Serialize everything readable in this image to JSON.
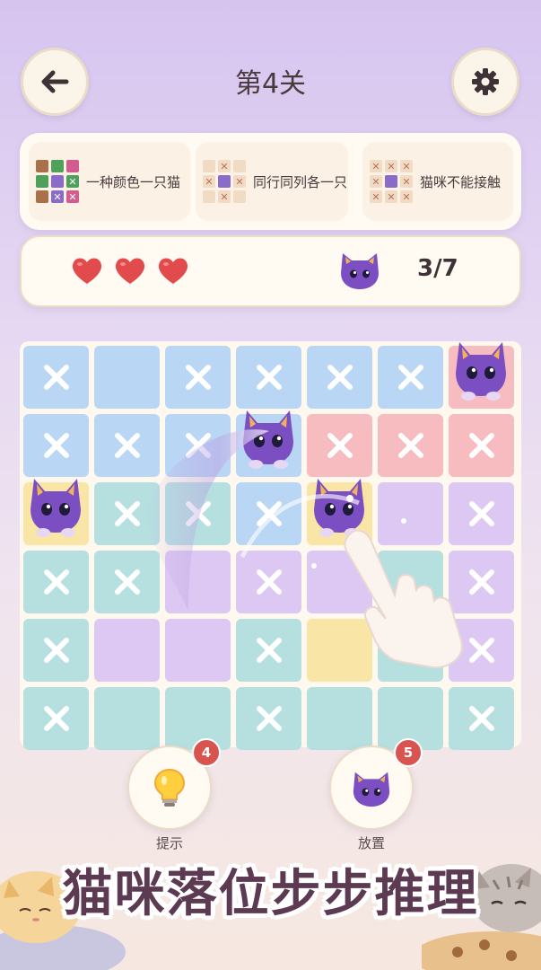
{
  "header": {
    "title": "第4关",
    "back_icon": "arrow-left-icon",
    "settings_icon": "gear-icon"
  },
  "rules": [
    {
      "label": "一种颜色一只猫",
      "icon": "color-grid-icon"
    },
    {
      "label": "同行同列各一只",
      "icon": "row-column-grid-icon"
    },
    {
      "label": "猫咪不能接触",
      "icon": "no-touch-grid-icon"
    }
  ],
  "status": {
    "lives": 3,
    "heart_color": "#e24b4b",
    "progress": "3/7",
    "cat_icon": "cat-face-icon"
  },
  "board": {
    "rows": 6,
    "cols": 7,
    "colors": {
      "blue": "#b9d6f5",
      "pink": "#f6bcc0",
      "yellow": "#f9e5a6",
      "teal": "#b6e0e0",
      "purple": "#dcc8f3"
    },
    "cells": [
      [
        "blue:x",
        "blue:",
        "blue:x",
        "blue:x",
        "blue:x",
        "blue:x",
        "pink:cat"
      ],
      [
        "blue:x",
        "blue:x",
        "blue:x",
        "blue:cat",
        "pink:x",
        "pink:x",
        "pink:x"
      ],
      [
        "yellow:cat",
        "teal:x",
        "teal:x",
        "blue:x",
        "yellow:cat",
        "purple:",
        "purple:x"
      ],
      [
        "teal:x",
        "teal:x",
        "purple:",
        "purple:x",
        "purple:",
        "teal:",
        "purple:x"
      ],
      [
        "teal:x",
        "purple:",
        "purple:",
        "teal:x",
        "yellow:",
        "teal:",
        "purple:x"
      ],
      [
        "teal:x",
        "teal:",
        "teal:",
        "teal:x",
        "teal:",
        "teal:",
        "teal:x"
      ]
    ]
  },
  "tools": [
    {
      "label": "提示",
      "badge": "4",
      "icon": "lightbulb-icon"
    },
    {
      "label": "放置",
      "badge": "5",
      "icon": "cat-face-icon"
    }
  ],
  "banner": "猫咪落位步步推理"
}
